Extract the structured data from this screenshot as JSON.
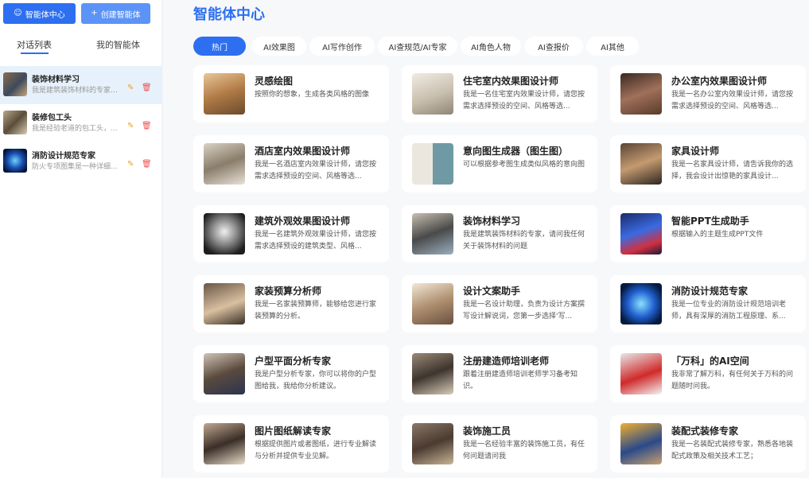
{
  "sidebar": {
    "btn_agent_center": "智能体中心",
    "btn_create_agent": "创建智能体",
    "tab_chats": "对话列表",
    "tab_my_agents": "我的智能体",
    "chats": [
      {
        "title": "装饰材料学习",
        "sub": "我是建筑装饰材料的专家，..."
      },
      {
        "title": "装修包工头",
        "sub": "我是经验老道的包工头，..."
      },
      {
        "title": "消防设计规范专家",
        "sub": "防火专项图集是一种详细..."
      }
    ]
  },
  "main": {
    "title": "智能体中心",
    "tabs": [
      "热门",
      "AI效果图",
      "AI写作创作",
      "AI查规范/AI专家",
      "AI角色人物",
      "AI查报价",
      "AI其他"
    ],
    "cards": [
      {
        "title": "灵感绘图",
        "desc": "按照你的想象，生成各类风格的图像"
      },
      {
        "title": "住宅室内效果图设计师",
        "desc": "我是一名住宅室内效果设计师，请您按需求选择预设的空间、风格等选..."
      },
      {
        "title": "办公室内效果图设计师",
        "desc": "我是一名办公室内效果设计师，请您按需求选择预设的空间、风格等选..."
      },
      {
        "title": "酒店室内效果图设计师",
        "desc": "我是一名酒店室内效果设计师，请您按需求选择预设的空间、风格等选..."
      },
      {
        "title": "意向图生成器（图生图）",
        "desc": "可以根据参考图生成类似风格的意向图"
      },
      {
        "title": "家具设计师",
        "desc": "我是一名家具设计师，请告诉我你的选择，我会设计出惊艳的家具设计..."
      },
      {
        "title": "建筑外观效果图设计师",
        "desc": "我是一名建筑外观效果设计师，请您按需求选择预设的建筑类型、风格..."
      },
      {
        "title": "装饰材料学习",
        "desc": "我是建筑装饰材料的专家，请问我任何关于装饰材料的问题"
      },
      {
        "title": "智能PPT生成助手",
        "desc": "根据输入的主题生成PPT文件"
      },
      {
        "title": "家装预算分析师",
        "desc": "我是一名家装预算师，能够给您进行家装预算的分析。"
      },
      {
        "title": "设计文案助手",
        "desc": "我是一名设计助理，负责为设计方案撰写设计解说词，您第一步选择'写..."
      },
      {
        "title": "消防设计规范专家",
        "desc": "我是一位专业的消防设计规范培训老师，具有深厚的消防工程原理、系..."
      },
      {
        "title": "户型平面分析专家",
        "desc": "我是户型分析专家，你可以将你的户型图给我，我给你分析建议。"
      },
      {
        "title": "注册建造师培训老师",
        "desc": "跟着注册建造师培训老师学习备考知识。"
      },
      {
        "title": "「万科」的AI空间",
        "desc": "我非常了解万科，有任何关于万科的问题随时问我。"
      },
      {
        "title": "图片图纸解读专家",
        "desc": "根据提供图片或者图纸，进行专业解读与分析并提供专业见解。"
      },
      {
        "title": "装饰施工员",
        "desc": "我是一名经验丰富的装饰施工员，有任何问题请问我"
      },
      {
        "title": "装配式装修专家",
        "desc": "我是一名装配式装修专家，熟悉各地装配式政策及相关技术工艺；"
      }
    ]
  }
}
